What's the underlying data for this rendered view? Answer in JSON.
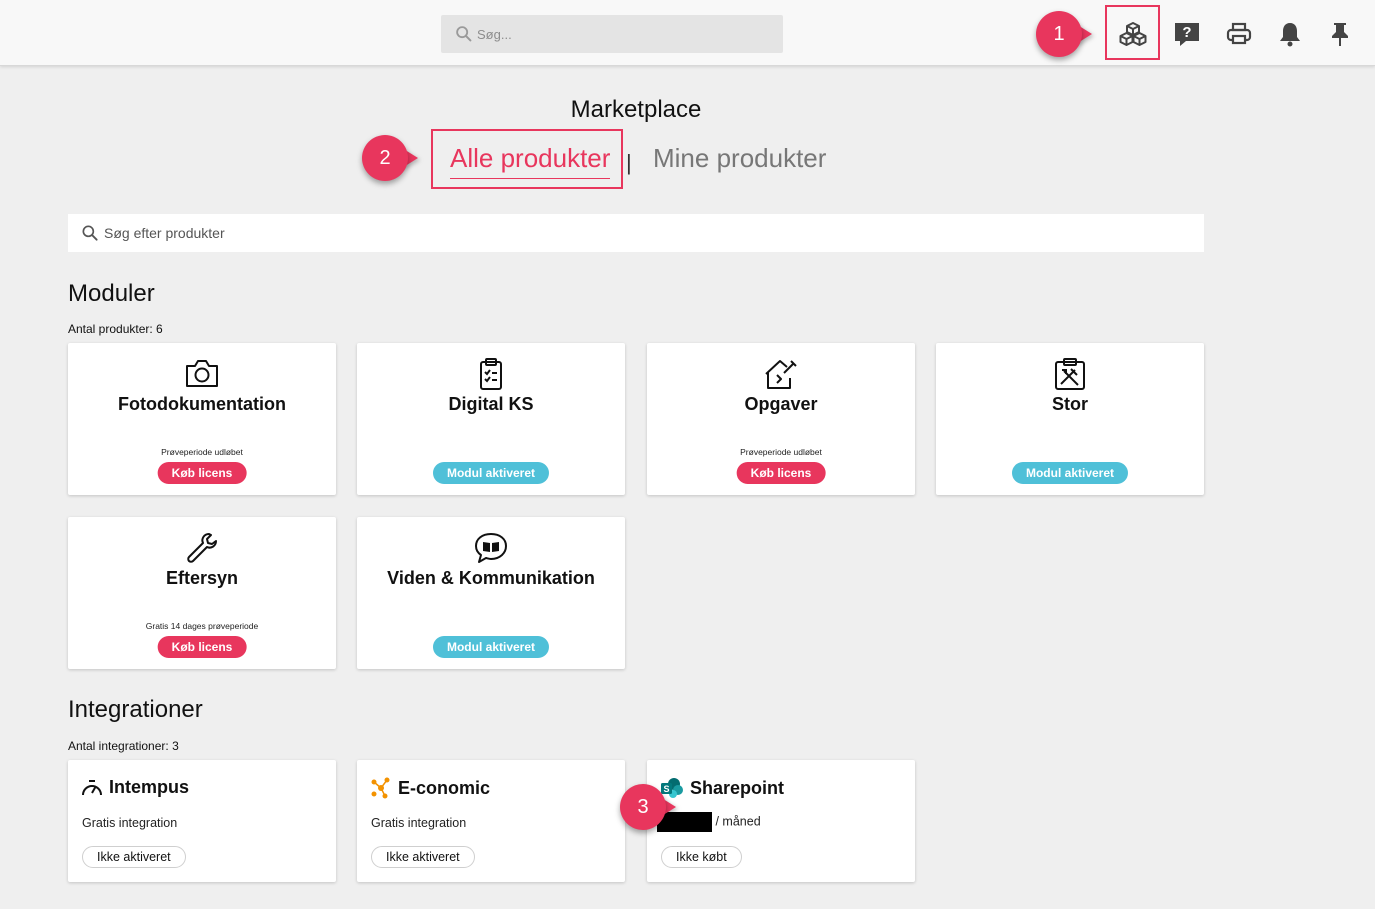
{
  "topbar": {
    "search_placeholder": "Søg...",
    "icons": [
      "marketplace-cubes-icon",
      "help-icon",
      "print-icon",
      "bell-icon",
      "pin-icon"
    ]
  },
  "annotations": {
    "callout_1": "1",
    "callout_2": "2",
    "callout_3": "3",
    "accent_color": "#e8365d"
  },
  "page": {
    "title": "Marketplace",
    "tabs": [
      {
        "label": "Alle produkter",
        "active": true
      },
      {
        "label": "Mine produkter",
        "active": false
      }
    ],
    "tab_separator": "|",
    "search_placeholder": "Søg efter produkter"
  },
  "modules": {
    "title": "Moduler",
    "count_text": "Antal produkter: 6",
    "items": [
      {
        "title": "Fotodokumentation",
        "icon": "camera-icon",
        "note": "Prøveperiode udløbet",
        "button": "Køb licens",
        "status": "buy"
      },
      {
        "title": "Digital KS",
        "icon": "clipboard-checklist-icon",
        "note": "",
        "button": "Modul aktiveret",
        "status": "active"
      },
      {
        "title": "Opgaver",
        "icon": "house-tools-icon",
        "note": "Prøveperiode udløbet",
        "button": "Køb licens",
        "status": "buy"
      },
      {
        "title": "Stor",
        "icon": "clipboard-tools-icon",
        "note": "",
        "button": "Modul aktiveret",
        "status": "active"
      },
      {
        "title": "Eftersyn",
        "icon": "wrench-icon",
        "note": "Gratis 14 dages prøveperiode",
        "button": "Køb licens",
        "status": "buy"
      },
      {
        "title": "Viden & Kommunikation",
        "icon": "chat-book-icon",
        "note": "",
        "button": "Modul aktiveret",
        "status": "active"
      }
    ]
  },
  "integrations": {
    "title": "Integrationer",
    "count_text": "Antal integrationer: 3",
    "items": [
      {
        "title": "Intempus",
        "icon": "speedometer-icon",
        "subtitle": "Gratis integration",
        "button": "Ikke aktiveret"
      },
      {
        "title": "E-conomic",
        "icon": "economic-logo-icon",
        "subtitle": "Gratis integration",
        "button": "Ikke aktiveret"
      },
      {
        "title": "Sharepoint",
        "icon": "sharepoint-logo-icon",
        "subtitle": "/ måned",
        "button": "Ikke købt"
      }
    ]
  },
  "colors": {
    "buy_pill": "#e8365d",
    "active_pill": "#4fc0d8",
    "background": "#efefef"
  }
}
